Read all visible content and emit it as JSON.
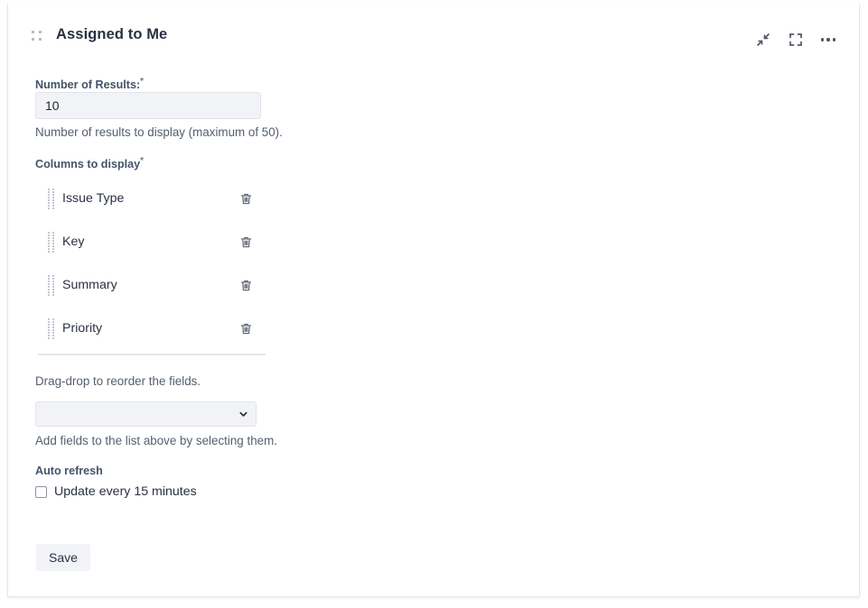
{
  "card": {
    "accent_color": "#3b7fe0",
    "title": "Assigned to Me",
    "drag_handle_name": "drag-handle",
    "actions": {
      "collapse_label": "collapse",
      "fullscreen_label": "fullscreen",
      "more_label": "more options"
    }
  },
  "form": {
    "number_of_results": {
      "label": "Number of Results:",
      "required_marker": "*",
      "value": "10",
      "help": "Number of results to display (maximum of 50)."
    },
    "columns": {
      "label": "Columns to display",
      "required_marker": "*",
      "items": [
        {
          "name": "Issue Type",
          "delete_label": "delete"
        },
        {
          "name": "Key",
          "delete_label": "delete"
        },
        {
          "name": "Summary",
          "delete_label": "delete"
        },
        {
          "name": "Priority",
          "delete_label": "delete"
        }
      ],
      "reorder_help": "Drag-drop to reorder the fields.",
      "add_select": {
        "value": "",
        "placeholder": "",
        "help": "Add fields to the list above by selecting them."
      }
    },
    "auto_refresh": {
      "label": "Auto refresh",
      "checkbox_label": "Update every 15 minutes",
      "checked": false
    },
    "save_label": "Save"
  }
}
